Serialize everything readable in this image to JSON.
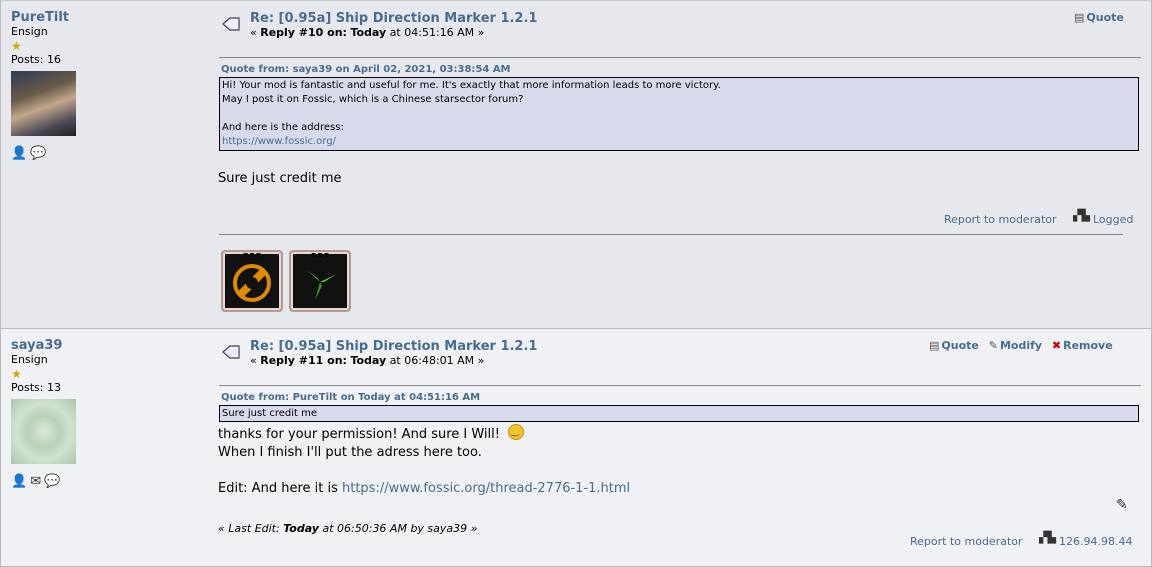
{
  "posts": [
    {
      "author": "PureTilt",
      "rank": "Ensign",
      "posts_count": "Posts: 16",
      "title": "Re: [0.95a] Ship Direction Marker 1.2.1",
      "reply_prefix": "« ",
      "reply_num": "Reply #10 on:",
      "reply_day": "Today",
      "reply_time": "at 04:51:16 AM »",
      "actions": [
        "Quote"
      ],
      "quote_header": "Quote from: saya39 on April 02, 2021, 03:38:54 AM",
      "quote_lines": [
        "Hi! Your mod is fantastic and useful for me. It's exactly that more information leads to more victory.",
        "May I post it on Fossic, which is a Chinese starsector forum?",
        "",
        "And here is the address:"
      ],
      "quote_link": "https://www.fossic.org/",
      "body": "Sure just credit me",
      "report": "Report to moderator",
      "logged": "Logged"
    },
    {
      "author": "saya39",
      "rank": "Ensign",
      "posts_count": "Posts: 13",
      "title": "Re: [0.95a] Ship Direction Marker 1.2.1",
      "reply_prefix": "« ",
      "reply_num": "Reply #11 on:",
      "reply_day": "Today",
      "reply_time": "at 06:48:01 AM »",
      "actions": [
        "Quote",
        "Modify",
        "Remove"
      ],
      "quote_header": "Quote from: PureTilt on Today at 04:51:16 AM",
      "quote_text": "Sure just credit me",
      "body_line1": "thanks for your permission! And sure I Will!",
      "body_line2": "When I finish I'll put the adress here too.",
      "body_line3_prefix": "Edit: And here it is ",
      "body_link": "https://www.fossic.org/thread-2776-1-1.html",
      "last_edit_prefix": "« Last Edit: ",
      "last_edit_day": "Today",
      "last_edit_rest": " at 06:50:36 AM by saya39 »",
      "report": "Report to moderator",
      "ip": "126.94.98.44"
    }
  ],
  "colors": {
    "link": "#476c8e",
    "quote_bg": "#d7daec",
    "post_bg_1": "#e6e8ee",
    "post_bg_2": "#f0f1f4"
  }
}
